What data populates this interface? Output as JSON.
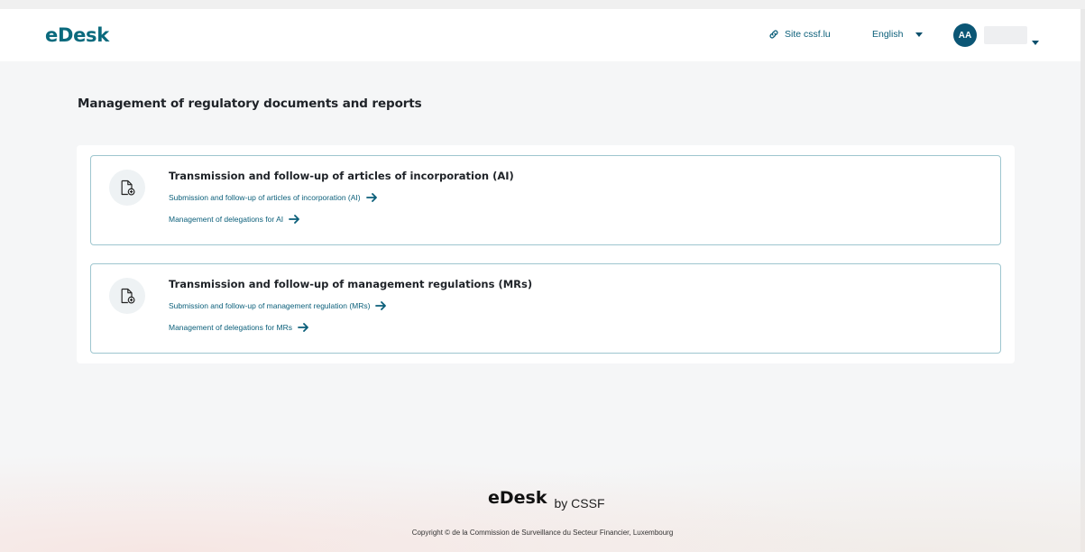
{
  "header": {
    "logo": "eDesk",
    "site_link": "Site cssf.lu",
    "language": "English",
    "avatar_initials": "AA"
  },
  "main": {
    "title": "Management of regulatory documents and reports",
    "cards": [
      {
        "title": "Transmission and follow-up of articles of incorporation (AI)",
        "links": [
          "Submission and follow-up of articles of incorporation (AI)",
          "Management of delegations for AI"
        ],
        "icon": "document-add-icon"
      },
      {
        "title": "Transmission and follow-up of management regulations (MRs)",
        "links": [
          "Submission and follow-up of management regulation (MRs)",
          "Management of delegations for MRs"
        ],
        "icon": "document-add-icon"
      }
    ]
  },
  "footer": {
    "logo": "eDesk",
    "by": "by CSSF",
    "copyright": "Copyright © de la Commission de Surveillance du Secteur Financier, Luxembourg"
  },
  "colors": {
    "brand": "#0b6a7d",
    "link": "#0b5f7a",
    "avatar": "#0b5675",
    "card_border": "#9ec6cf"
  }
}
